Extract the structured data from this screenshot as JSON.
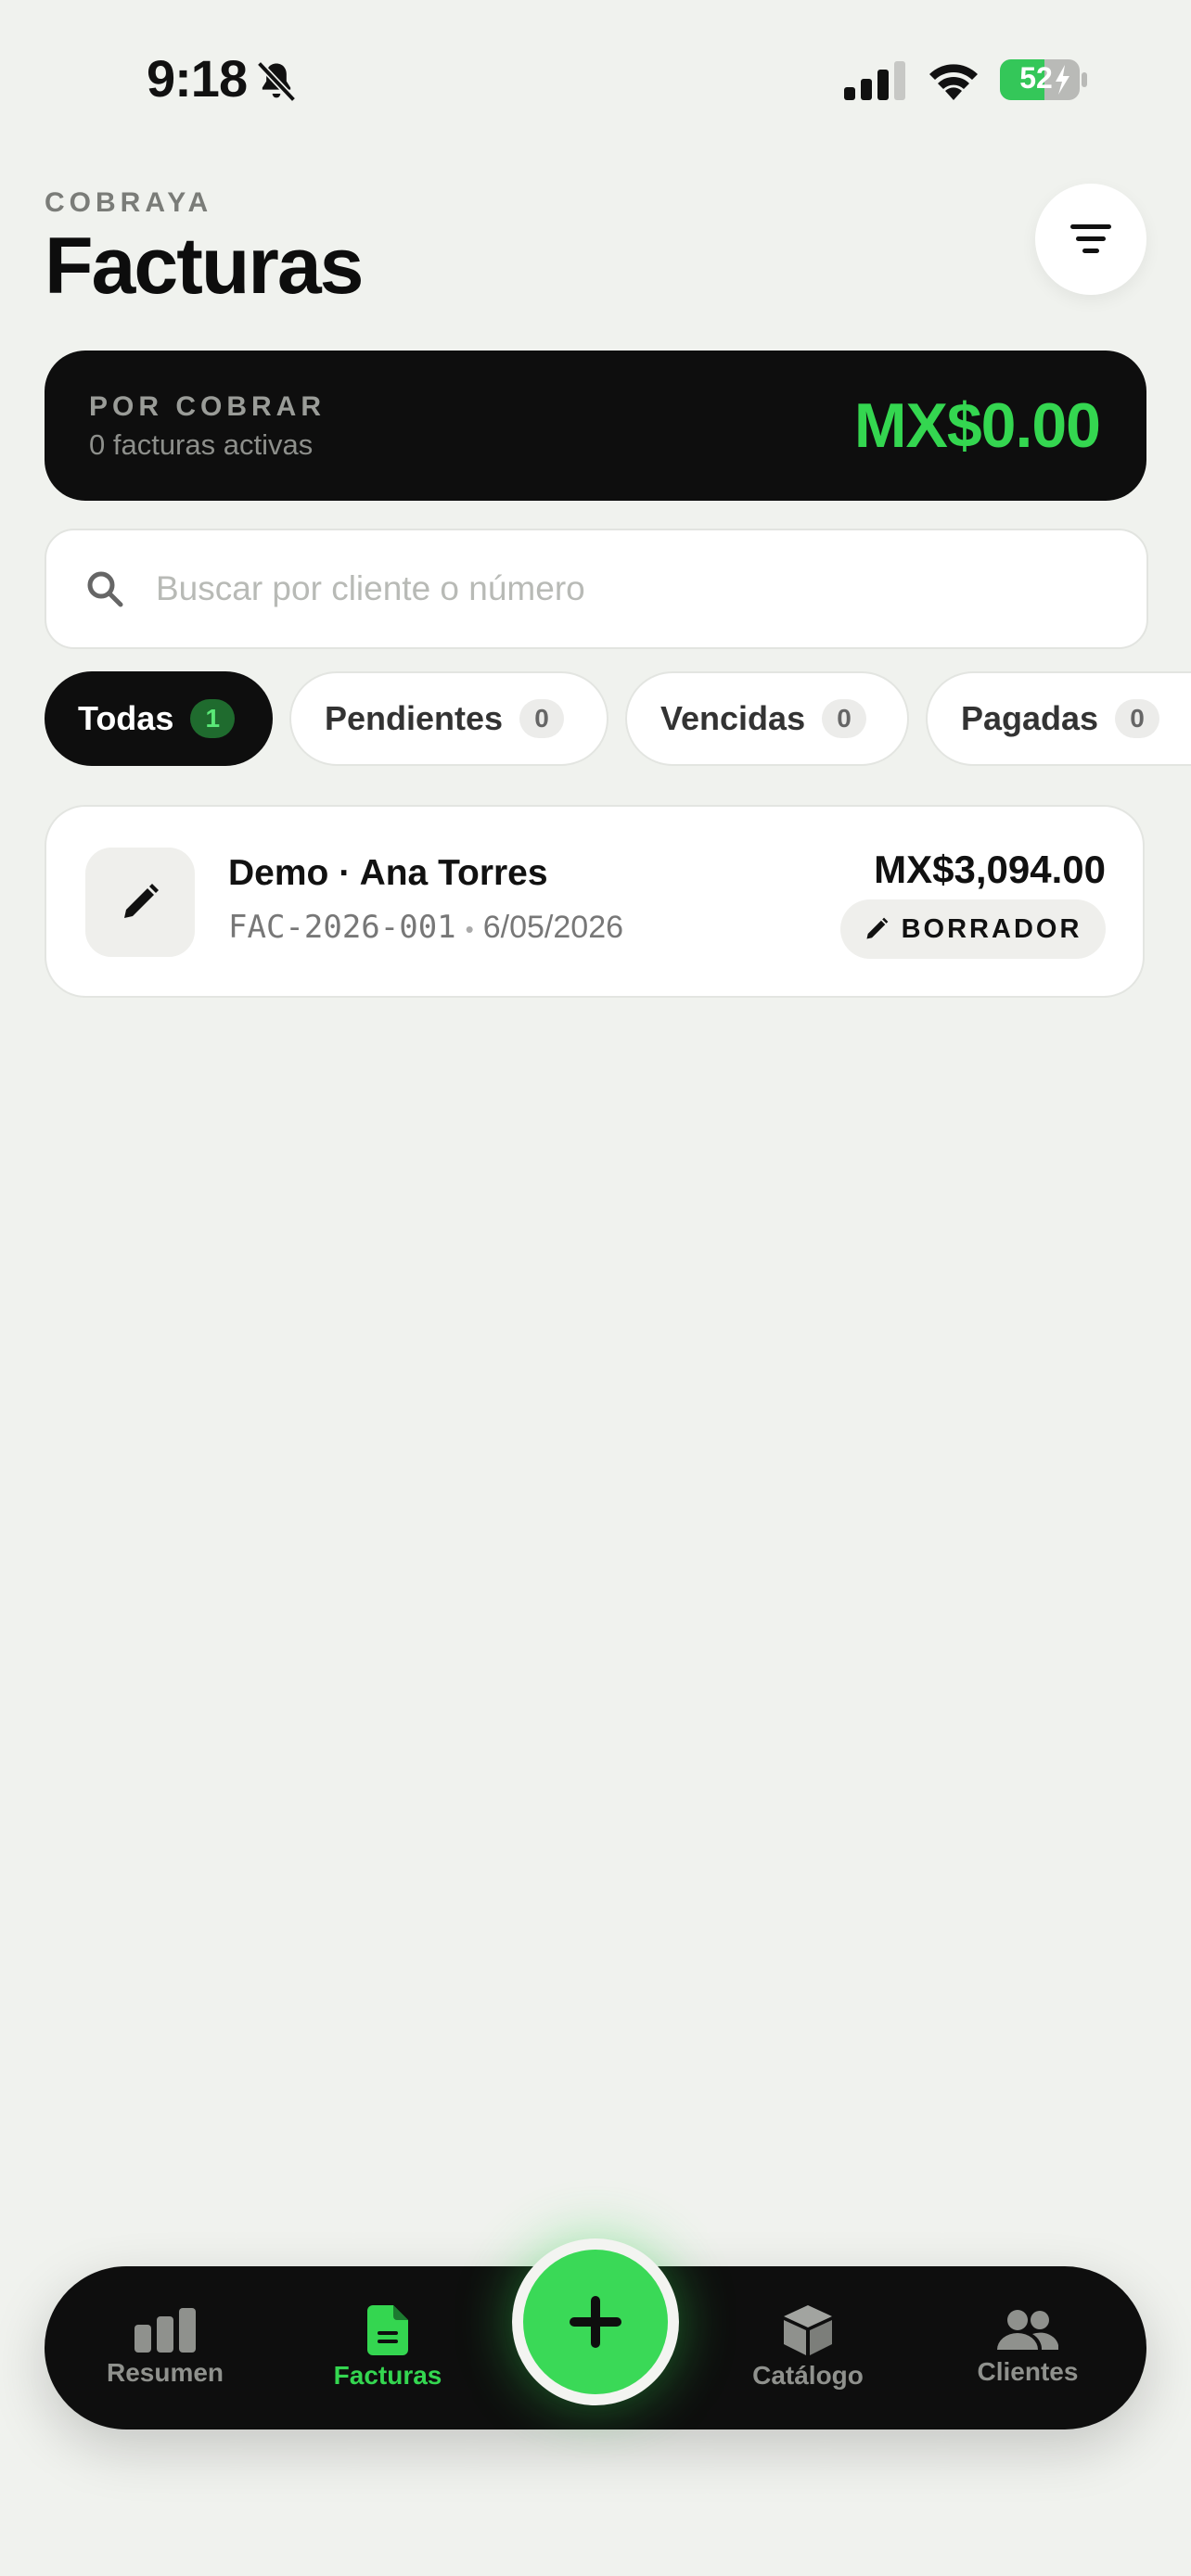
{
  "status_bar": {
    "time": "9:18",
    "battery": "52"
  },
  "header": {
    "brand": "COBRAYA",
    "title": "Facturas"
  },
  "summary": {
    "label": "POR COBRAR",
    "subtitle": "0 facturas activas",
    "amount": "MX$0.00"
  },
  "search": {
    "placeholder": "Buscar por cliente o número",
    "value": ""
  },
  "filters": [
    {
      "label": "Todas",
      "count": "1",
      "active": true
    },
    {
      "label": "Pendientes",
      "count": "0",
      "active": false
    },
    {
      "label": "Vencidas",
      "count": "0",
      "active": false
    },
    {
      "label": "Pagadas",
      "count": "0",
      "active": false
    }
  ],
  "invoices": [
    {
      "name": "Demo · Ana Torres",
      "number": "FAC-2026-001",
      "separator": "•",
      "date": "6/05/2026",
      "amount": "MX$3,094.00",
      "status": "BORRADOR",
      "icon": "pencil-icon"
    }
  ],
  "tabbar": {
    "items": [
      {
        "label": "Resumen",
        "icon": "bar-chart-icon",
        "active": false
      },
      {
        "label": "Facturas",
        "icon": "document-icon",
        "active": true
      },
      {
        "label": "Catálogo",
        "icon": "box-icon",
        "active": false
      },
      {
        "label": "Clientes",
        "icon": "users-icon",
        "active": false
      }
    ],
    "fab_icon": "plus-icon"
  },
  "colors": {
    "accent": "#34d650",
    "dark": "#0e0e0e",
    "background": "#f0f2ee"
  }
}
